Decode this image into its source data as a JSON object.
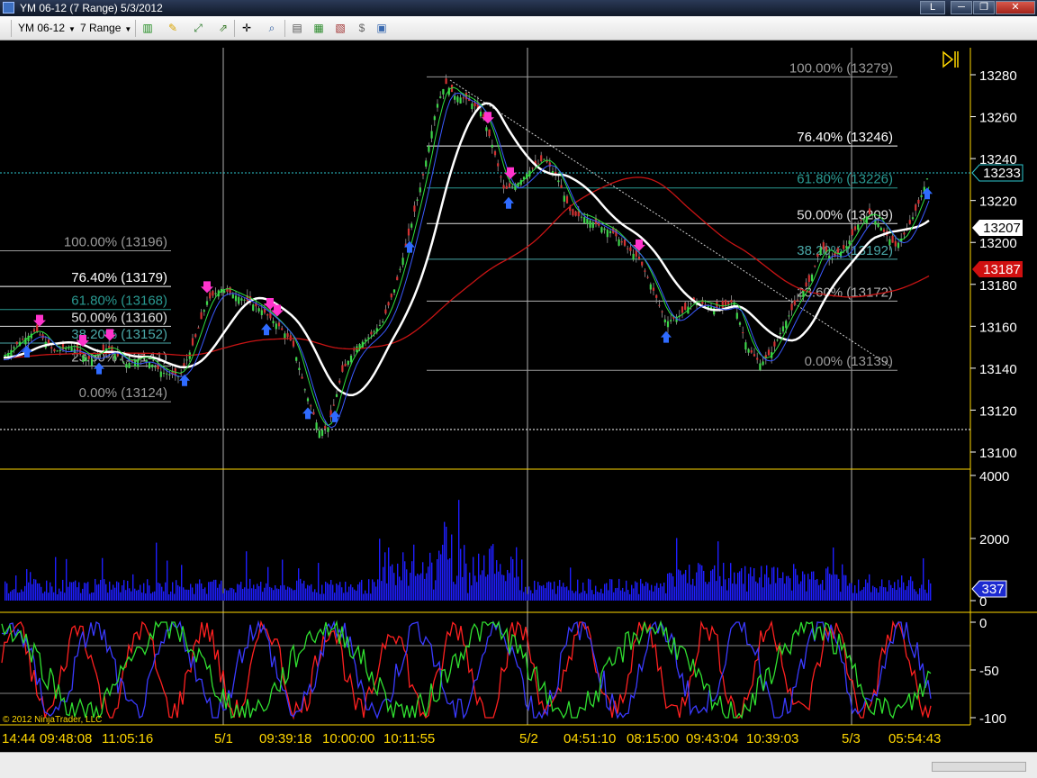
{
  "window": {
    "title": "YM 06-12 (7 Range)  5/3/2012",
    "buttons": {
      "link": "L",
      "minimize": "─",
      "restore": "❐",
      "close": "✕"
    }
  },
  "toolbar": {
    "instrument": "YM 06-12",
    "interval": "7 Range",
    "icons": [
      "bar-type-icon",
      "draw-pencil-icon",
      "drawing-tools-icon",
      "signal-icon",
      "crosshair-icon",
      "zoom-icon",
      "properties-icon",
      "strategies-icon",
      "chart-trader-icon",
      "data-box-icon",
      "window-options-icon"
    ]
  },
  "colors": {
    "background": "#000000",
    "axis_text": "#ffffff",
    "time_text": "#ffd700",
    "grid": "#c8c8c8",
    "candle_up": "#3dd64a",
    "candle_down": "#d33232",
    "ema_fast": "#ffffff",
    "sma_slow": "#c81414",
    "volume": "#1e1eff",
    "stoch_red": "#ff2020",
    "stoch_green": "#30e030",
    "stoch_blue": "#3a3aff",
    "current_price_line": "#2ec8d0",
    "divider": "#ffd700",
    "arrow_up_marker": "#2f6bff",
    "arrow_down_marker": "#ff33cc"
  },
  "price_axis": {
    "ticks": [
      "13280",
      "13260",
      "13240",
      "13220",
      "13200",
      "13180",
      "13160",
      "13140",
      "13120",
      "13100"
    ],
    "min": 13100,
    "max": 13280,
    "current_price": "13233",
    "ema_value": "13207",
    "sma_value": "13187"
  },
  "volume_axis": {
    "ticks": [
      "4000",
      "2000",
      "0"
    ],
    "current": "337"
  },
  "stoch_axis": {
    "ticks": [
      "0",
      "-50",
      "-100"
    ]
  },
  "time_axis": {
    "labels": [
      "14:44",
      "09:48:08",
      "11:05:16",
      "5/1",
      "09:39:18",
      "10:00:00",
      "10:11:55",
      "5/2",
      "04:51:10",
      "08:15:00",
      "09:43:04",
      "10:39:03",
      "5/3",
      "05:54:43"
    ]
  },
  "fib_right": {
    "levels": [
      {
        "label": "100.00% (13279)",
        "color": "#9a9a9a",
        "price": 13279
      },
      {
        "label": "76.40% (13246)",
        "color": "#ffffff",
        "price": 13246
      },
      {
        "label": "61.80% (13226)",
        "color": "#2a9a92",
        "price": 13226
      },
      {
        "label": "50.00% (13209)",
        "color": "#e0e0e0",
        "price": 13209
      },
      {
        "label": "38.20% (13192)",
        "color": "#4aa8a8",
        "price": 13192
      },
      {
        "label": "23.60% (13172)",
        "color": "#b0b0b0",
        "price": 13172
      },
      {
        "label": "0.00% (13139)",
        "color": "#9a9a9a",
        "price": 13139
      }
    ]
  },
  "fib_left": {
    "levels": [
      {
        "label": "100.00% (13196)",
        "color": "#9a9a9a",
        "price": 13196
      },
      {
        "label": "76.40% (13179)",
        "color": "#ffffff",
        "price": 13179
      },
      {
        "label": "61.80% (13168)",
        "color": "#2a9a92",
        "price": 13168
      },
      {
        "label": "50.00% (13160)",
        "color": "#e0e0e0",
        "price": 13160
      },
      {
        "label": "38.20% (13152)",
        "color": "#4aa8a8",
        "price": 13152
      },
      {
        "label": "23.60% (13141)",
        "color": "#b0b0b0",
        "price": 13141
      },
      {
        "label": "0.00% (13124)",
        "color": "#9a9a9a",
        "price": 13124
      }
    ]
  },
  "copyright": "© 2012 NinjaTrader, LLC"
}
